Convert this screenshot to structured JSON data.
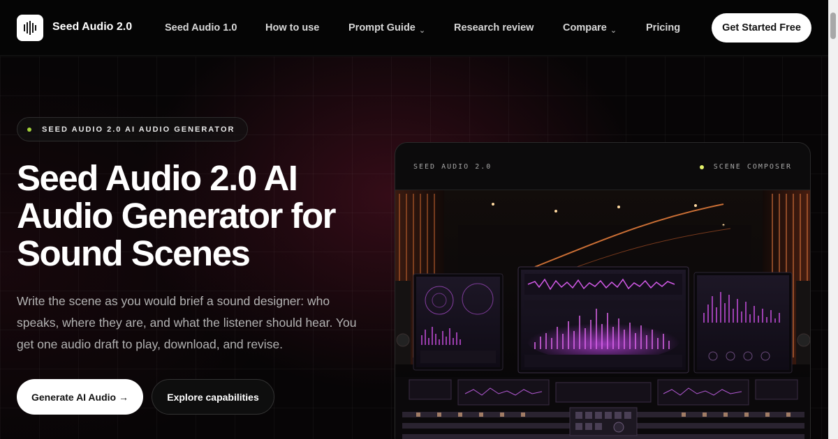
{
  "header": {
    "brand": "Seed Audio 2.0",
    "nav": [
      {
        "label": "Seed Audio 1.0"
      },
      {
        "label": "How to use"
      },
      {
        "label": "Prompt Guide"
      },
      {
        "label": "Research review"
      },
      {
        "label": "Compare"
      },
      {
        "label": "Pricing"
      }
    ],
    "cta": "Get Started Free"
  },
  "hero": {
    "badge": "SEED AUDIO 2.0 AI AUDIO GENERATOR",
    "title_line1": "Seed Audio 2.0 AI",
    "title_line2": "Audio Generator for",
    "title_line3": "Sound Scenes",
    "description": "Write the scene as you would brief a sound designer: who speaks, where they are, and what the listener should hear. You get one audio draft to play, download, and revise.",
    "primary_button": "Generate AI Audio →",
    "secondary_button": "Explore capabilities"
  },
  "preview": {
    "label": "SEED AUDIO 2.0",
    "status": "SCENE COMPOSER"
  },
  "colors": {
    "accent_green": "#a3d13a",
    "status_yellow": "#e4f26b",
    "waveform_purple": "#c94fe0",
    "warm_orange": "#e07a3a"
  }
}
